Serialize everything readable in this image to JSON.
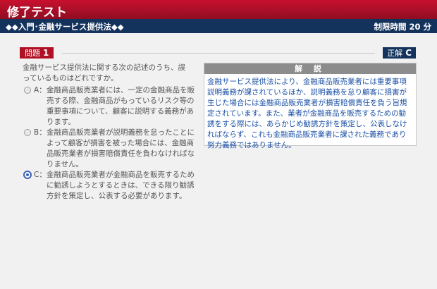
{
  "header": {
    "app_title": "修了テスト",
    "course_title": "◆◆入門･金融サービス提供法◆◆",
    "time_limit_label": "制限時間",
    "time_limit_value": "20 分"
  },
  "question": {
    "badge_label": "問題",
    "number": "1",
    "answer_label": "正解",
    "answer_value": "C",
    "prompt": "金融サービス提供法に関する次の記述のうち、誤っているものはどれですか。",
    "options": [
      {
        "letter": "A：",
        "text": "金融商品販売業者には、一定の金融商品を販売する際、金融商品がもっているリスク等の重要事項について、顧客に説明する義務があります。",
        "selected": false
      },
      {
        "letter": "B：",
        "text": "金融商品販売業者が説明義務を怠ったことによって顧客が損害を被った場合には、金融商品販売業者が損害賠償責任を負わなければなりません。",
        "selected": false
      },
      {
        "letter": "C：",
        "text": "金融商品販売業者が金融商品を販売するために勧誘しようとするときは、できる限り勧誘方針を策定し、公表する必要があります。",
        "selected": true
      }
    ]
  },
  "explanation": {
    "title": "解 説",
    "body": "金融サービス提供法により、金融商品販売業者には重要事項説明義務が課されているほか、説明義務を怠り顧客に損害が生じた場合には金融商品販売業者が損害賠償責任を負う旨規定されています。また、業者が金融商品を販売するための勧誘をする際には、あらかじめ勧誘方針を策定し、公表しなければならず、これも金融商品販売業者に課された義務であり努力義務ではありません。"
  },
  "colors": {
    "brand_red": "#b01024",
    "navy": "#13335d",
    "explanation_text": "#1b50a6",
    "selected_radio": "#3d61b5"
  }
}
